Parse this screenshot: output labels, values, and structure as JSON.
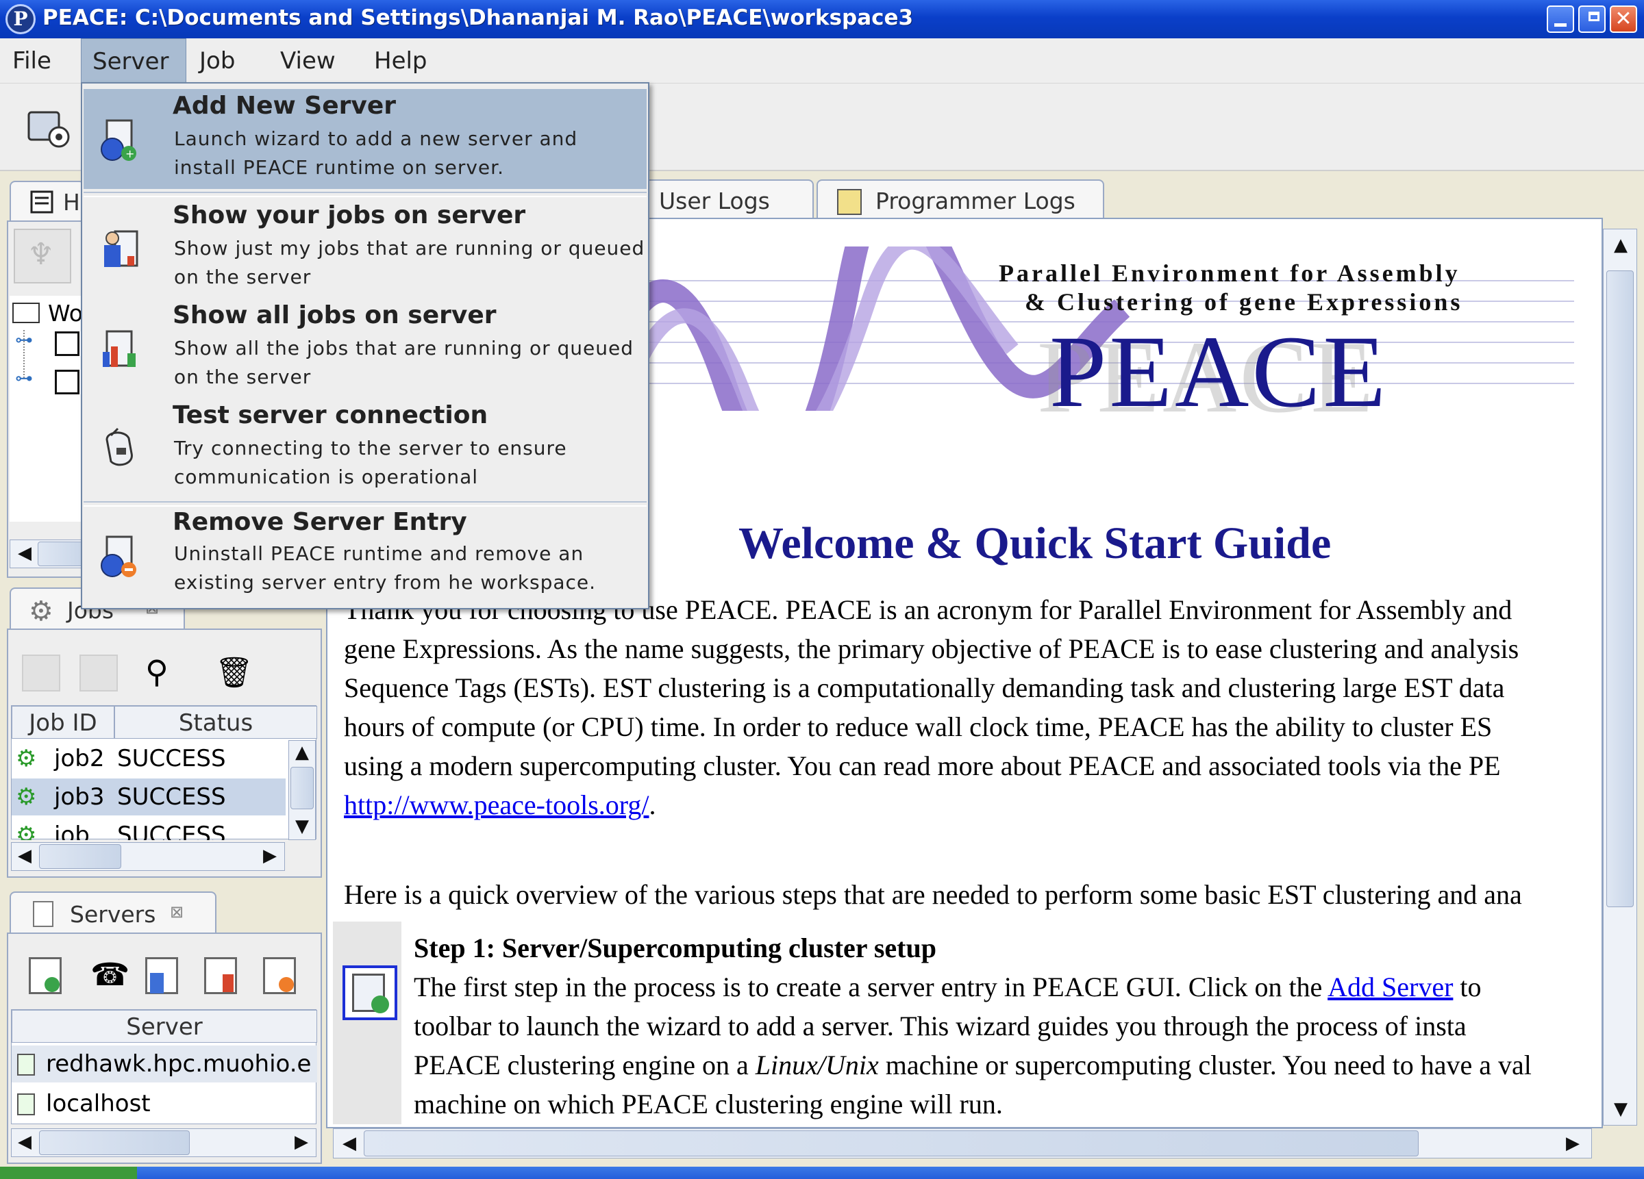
{
  "window": {
    "title": "PEACE: C:\\Documents and Settings\\Dhananjai M. Rao\\PEACE\\workspace3",
    "app_icon": "P"
  },
  "menubar": {
    "items": [
      "File",
      "Server",
      "Job",
      "View",
      "Help"
    ],
    "open_menu": "Server"
  },
  "server_menu": {
    "items": [
      {
        "title": "Add New Server",
        "desc1": "Launch wizard to add a new server and",
        "desc2": "install PEACE runtime on server.",
        "icon": "add-server-icon",
        "highlighted": true
      },
      {
        "title": "Show your jobs on server",
        "desc1": "Show just my jobs that are running or queued",
        "desc2": "on the server",
        "icon": "user-jobs-icon"
      },
      {
        "title": "Show all jobs on server",
        "desc1": "Show all the jobs that are running or queued",
        "desc2": "on the server",
        "icon": "all-jobs-icon"
      },
      {
        "title": "Test server connection",
        "desc1": "Try connecting to the server to ensure",
        "desc2": "communication is operational",
        "icon": "test-connection-icon"
      },
      {
        "title": "Remove Server Entry",
        "desc1": "Uninstall PEACE runtime and remove an",
        "desc2": "existing server entry from he workspace.",
        "icon": "remove-server-icon"
      }
    ]
  },
  "workspace_panel": {
    "tab_label_partial": "H",
    "tree_root_partial": "Wo"
  },
  "jobs_panel": {
    "tab_label": "Jobs",
    "columns": [
      "Job ID",
      "Status"
    ],
    "rows": [
      {
        "id": "job2",
        "status": "SUCCESS"
      },
      {
        "id": "job3",
        "status": "SUCCESS",
        "selected": true
      },
      {
        "id": "job",
        "status": "SUCCESS"
      }
    ]
  },
  "servers_panel": {
    "tab_label": "Servers",
    "column": "Server",
    "rows": [
      "redhawk.hpc.muohio.e",
      "localhost"
    ]
  },
  "content_tabs": {
    "user_logs": "User Logs",
    "programmer_logs": "Programmer Logs"
  },
  "document": {
    "banner_line1": "Parallel Environment for Assembly",
    "banner_line2": "& Clustering of gene Expressions",
    "banner_logo": "PEACE",
    "heading": "Welcome & Quick Start Guide",
    "p1_lines": [
      "Thank you for choosing to use PEACE. PEACE is an acronym for Parallel Environment for Assembly and",
      "gene Expressions. As the name suggests, the primary objective of PEACE is to ease clustering and analysis",
      "Sequence Tags (ESTs). EST clustering is a computationally demanding task and clustering large EST data",
      "hours of compute (or CPU) time. In order to reduce wall clock time, PEACE has the ability to cluster ES",
      "using a modern supercomputing cluster. You can read more about PEACE and associated tools via the PE"
    ],
    "link": "http://www.peace-tools.org/",
    "p2": "Here is a quick overview of the various steps that are needed to perform some basic EST clustering and ana",
    "step1_title": "Step 1: Server/Supercomputing cluster setup",
    "step1_l1_pre": "The first step in the process is to create a server entry in PEACE GUI. Click on the ",
    "step1_l1_link": "Add Server",
    "step1_l1_post": " to",
    "step1_l2": "toolbar to launch the wizard to add a server. This wizard guides you through the process of insta",
    "step1_l3_pre": "PEACE clustering engine on a ",
    "step1_l3_em": "Linux/Unix",
    "step1_l3_post": " machine or supercomputing cluster. You need to have a val",
    "step1_l4": "machine on which PEACE clustering engine will run."
  },
  "colors": {
    "titlebar": "#0a3fc9",
    "menu_highlight": "#a9bcd2",
    "heading": "#1a1a8c",
    "link": "#0000ee"
  }
}
